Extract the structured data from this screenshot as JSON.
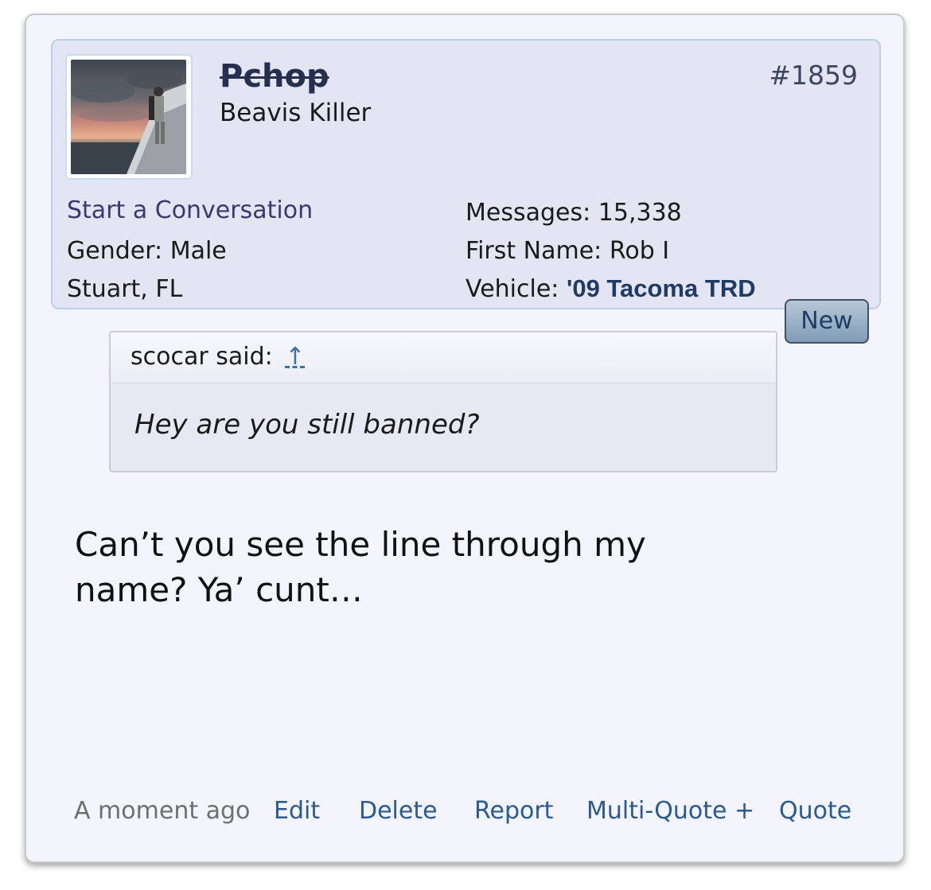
{
  "post": {
    "username": "Pchop",
    "user_title": "Beavis Killer",
    "post_number": "#1859",
    "start_conversation": "Start a Conversation",
    "gender_label": "Gender:",
    "gender_value": "Male",
    "location": "Stuart, FL",
    "messages_label": "Messages:",
    "messages_value": "15,338",
    "first_name_label": "First Name:",
    "first_name_value": "Rob I",
    "vehicle_label": "Vehicle:",
    "vehicle_value": "'09 Tacoma TRD",
    "new_badge": "New"
  },
  "quote": {
    "author_said": "scocar said:",
    "jump_icon": "↑",
    "text": "Hey are you still banned?"
  },
  "message": {
    "line1": "Can’t you see the line through my",
    "line2": "name? Ya’ cunt…"
  },
  "footer": {
    "timestamp": "A moment ago",
    "edit": "Edit",
    "delete": "Delete",
    "report": "Report",
    "multi_quote": "Multi-Quote +",
    "quote": "Quote"
  }
}
